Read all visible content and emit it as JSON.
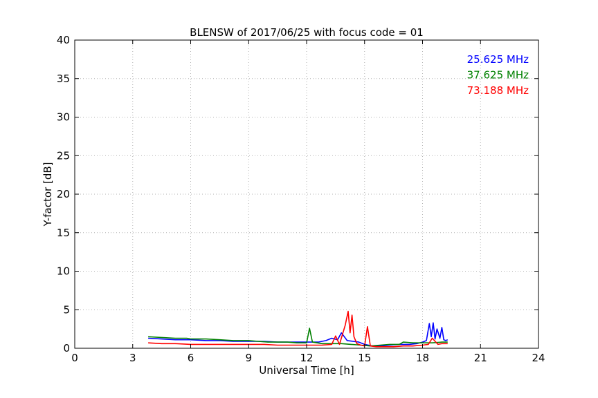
{
  "chart_data": {
    "type": "line",
    "title": "BLENSW of 2017/06/25 with focus code = 01",
    "xlabel": "Universal Time [h]",
    "ylabel": "Y-factor [dB]",
    "xlim": [
      0,
      24
    ],
    "ylim": [
      0,
      40
    ],
    "xticks": [
      0,
      3,
      6,
      9,
      12,
      15,
      18,
      21,
      24
    ],
    "yticks": [
      0,
      5,
      10,
      15,
      20,
      25,
      30,
      35,
      40
    ],
    "grid": true,
    "legend_placement": "top-right",
    "series": [
      {
        "name": "25.625 MHz",
        "color": "#0000ff",
        "x": [
          3.8,
          4.5,
          5.2,
          6.0,
          6.8,
          7.5,
          8.2,
          9.0,
          9.8,
          10.5,
          11.2,
          12.0,
          12.6,
          13.0,
          13.3,
          13.6,
          13.8,
          14.1,
          14.4,
          14.7,
          15.0,
          15.4,
          15.8,
          16.3,
          16.8,
          17.3,
          17.7,
          18.0,
          18.2,
          18.35,
          18.45,
          18.55,
          18.65,
          18.75,
          18.9,
          19.0,
          19.1,
          19.2,
          19.3
        ],
        "y": [
          1.3,
          1.2,
          1.1,
          1.1,
          1.0,
          1.0,
          0.9,
          0.9,
          0.9,
          0.8,
          0.8,
          0.8,
          0.8,
          1.0,
          1.3,
          1.1,
          2.0,
          1.0,
          0.9,
          0.8,
          0.5,
          0.3,
          0.3,
          0.4,
          0.5,
          0.5,
          0.6,
          0.8,
          1.0,
          3.2,
          1.5,
          3.3,
          1.2,
          2.5,
          1.3,
          2.7,
          1.1,
          1.0,
          1.1
        ]
      },
      {
        "name": "37.625 MHz",
        "color": "#008000",
        "x": [
          3.8,
          4.5,
          5.2,
          5.8,
          6.0,
          6.8,
          7.5,
          8.2,
          9.0,
          9.5,
          10.0,
          10.5,
          11.0,
          11.5,
          12.0,
          12.15,
          12.3,
          12.8,
          13.3,
          13.8,
          14.3,
          14.8,
          15.3,
          15.8,
          16.3,
          16.8,
          17.0,
          17.5,
          18.0,
          18.5,
          19.0,
          19.3
        ],
        "y": [
          1.5,
          1.4,
          1.3,
          1.3,
          1.2,
          1.2,
          1.1,
          1.0,
          1.0,
          0.9,
          0.8,
          0.8,
          0.8,
          0.7,
          0.7,
          2.6,
          0.8,
          0.6,
          0.6,
          0.6,
          0.5,
          0.4,
          0.3,
          0.4,
          0.5,
          0.5,
          0.8,
          0.7,
          0.7,
          0.7,
          0.8,
          0.8
        ]
      },
      {
        "name": "73.188 MHz",
        "color": "#ff0000",
        "x": [
          3.8,
          4.5,
          5.2,
          6.0,
          6.8,
          7.5,
          8.2,
          9.0,
          9.8,
          10.5,
          11.2,
          12.0,
          12.8,
          13.3,
          13.5,
          13.7,
          14.0,
          14.15,
          14.25,
          14.35,
          14.45,
          14.6,
          14.8,
          15.0,
          15.15,
          15.3,
          15.6,
          16.0,
          16.5,
          17.0,
          17.5,
          18.0,
          18.3,
          18.5,
          18.8,
          19.0,
          19.3
        ],
        "y": [
          0.7,
          0.6,
          0.6,
          0.5,
          0.5,
          0.5,
          0.5,
          0.5,
          0.5,
          0.4,
          0.4,
          0.4,
          0.4,
          0.5,
          1.6,
          0.5,
          3.0,
          4.8,
          2.0,
          4.3,
          1.5,
          0.6,
          0.4,
          0.3,
          2.8,
          0.3,
          0.2,
          0.2,
          0.2,
          0.3,
          0.3,
          0.4,
          0.5,
          1.3,
          0.5,
          0.6,
          0.6
        ]
      }
    ]
  }
}
